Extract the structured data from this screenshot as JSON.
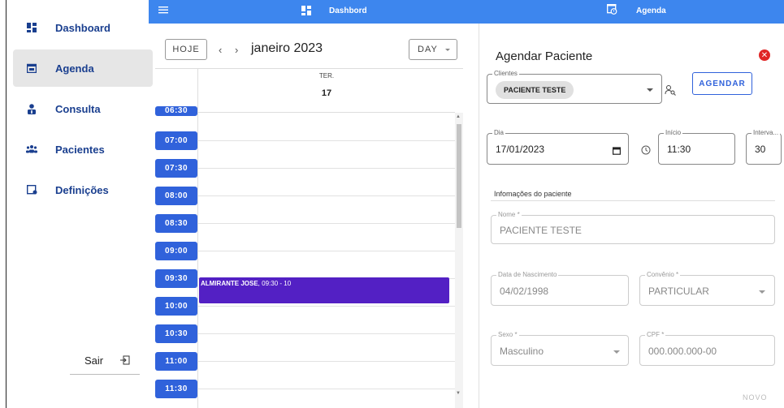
{
  "sidebar": {
    "items": [
      {
        "label": "Dashboard",
        "icon": "dashboard-icon",
        "active": false
      },
      {
        "label": "Agenda",
        "icon": "calendar-icon",
        "active": true
      },
      {
        "label": "Consulta",
        "icon": "doctor-icon",
        "active": false
      },
      {
        "label": "Pacientes",
        "icon": "people-icon",
        "active": false
      },
      {
        "label": "Definições",
        "icon": "settings-window-icon",
        "active": false
      }
    ],
    "logout_label": "Sair"
  },
  "topbar": {
    "dashboard_label": "Dashbord",
    "agenda_label": "Agenda",
    "color": "#3d86ee"
  },
  "calendar": {
    "today_label": "HOJE",
    "prev_label": "‹",
    "next_label": "›",
    "month_label": "janeiro 2023",
    "view_label": "DAY",
    "day_of_week": "TER.",
    "day_number": "17",
    "time_slots": [
      "06:30",
      "07:00",
      "07:30",
      "08:00",
      "08:30",
      "09:00",
      "09:30",
      "10:00",
      "10:30",
      "11:00",
      "11:30"
    ],
    "event": {
      "name": "ALMIRANTE JOSE",
      "time": ", 09:30 - 10",
      "color": "#5320c4"
    },
    "slot_color": "#3062db"
  },
  "panel": {
    "title": "Agendar Paciente",
    "clientes_legend": "Clientes",
    "clientes_chip": "PACIENTE TESTE",
    "agendar_label": "AGENDAR",
    "dia_legend": "Dia",
    "dia_value": "17/01/2023",
    "inicio_legend": "Início",
    "inicio_value": "11:30",
    "intervalo_legend": "Interva...",
    "intervalo_value": "30",
    "section_title": "Infomações do paciente",
    "nome_legend": "Nome *",
    "nome_value": "PACIENTE TESTE",
    "nascimento_legend": "Data de Nascimento",
    "nascimento_value": "04/02/1998",
    "convenio_legend": "Convênio *",
    "convenio_value": "PARTICULAR",
    "sexo_legend": "Sexo *",
    "sexo_value": "Masculino",
    "cpf_legend": "CPF *",
    "cpf_placeholder": "000.000.000-00",
    "novo_label": "NOVO"
  }
}
